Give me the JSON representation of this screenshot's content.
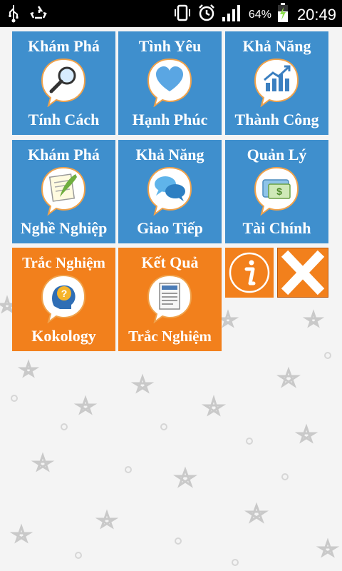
{
  "status_bar": {
    "battery_percent": "64%",
    "time": "20:49",
    "icons": [
      "usb-icon",
      "recycle-icon",
      "vibrate-icon",
      "alarm-icon",
      "signal-icon",
      "battery-charging-icon"
    ]
  },
  "tiles": [
    {
      "top": "Khám Phá",
      "bottom": "Tính Cách",
      "icon": "magnifier-icon",
      "color": "#3f8fcd"
    },
    {
      "top": "Tình Yêu",
      "bottom": "Hạnh Phúc",
      "icon": "heart-icon",
      "color": "#3f8fcd"
    },
    {
      "top": "Khả Năng",
      "bottom": "Thành Công",
      "icon": "growth-chart-icon",
      "color": "#3f8fcd"
    },
    {
      "top": "Khám Phá",
      "bottom": "Nghề Nghiệp",
      "icon": "quill-notepad-icon",
      "color": "#3f8fcd"
    },
    {
      "top": "Khả Năng",
      "bottom": "Giao Tiếp",
      "icon": "chat-bubbles-icon",
      "color": "#3f8fcd"
    },
    {
      "top": "Quản Lý",
      "bottom": "Tài Chính",
      "icon": "wallet-money-icon",
      "color": "#3f8fcd"
    },
    {
      "top": "Trắc Nghiệm",
      "bottom": "Kokology",
      "icon": "brain-question-icon",
      "color": "#f2801c"
    },
    {
      "top": "Kết Quả",
      "bottom": "Trắc Nghiệm",
      "icon": "document-icon",
      "color": "#f2801c"
    }
  ],
  "buttons": {
    "info_icon": "info-icon",
    "close_icon": "close-icon"
  },
  "colors": {
    "tile_blue": "#3f8fcd",
    "tile_orange": "#f2801c",
    "background": "#f4f4f4"
  }
}
